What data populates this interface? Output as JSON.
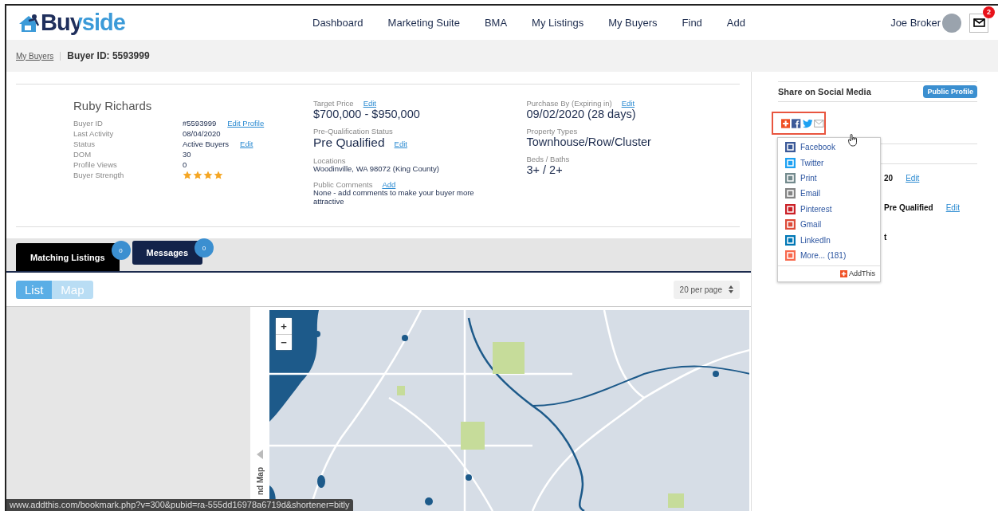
{
  "header": {
    "logo": "Buyside",
    "nav": [
      {
        "label": "Dashboard"
      },
      {
        "label": "Marketing Suite"
      },
      {
        "label": "BMA"
      },
      {
        "label": "My Listings"
      },
      {
        "label": "My Buyers"
      },
      {
        "label": "Find"
      },
      {
        "label": "Add"
      }
    ],
    "user_name": "Joe Broker",
    "mail_badge": "2"
  },
  "breadcrumb": {
    "link": "My Buyers",
    "current": "Buyer ID: 5593999"
  },
  "profile": {
    "name": "Ruby Richards",
    "fields": [
      {
        "label": "Buyer ID",
        "value": "#5593999",
        "action": "Edit Profile"
      },
      {
        "label": "Last Activity",
        "value": "08/04/2020"
      },
      {
        "label": "Status",
        "value": "Active Buyers",
        "action": "Edit"
      },
      {
        "label": "DOM",
        "value": "30"
      },
      {
        "label": "Profile Views",
        "value": "0"
      },
      {
        "label": "Buyer Strength",
        "stars": 4
      }
    ],
    "columns": [
      [
        {
          "label": "Target Price",
          "label_action": "Edit",
          "value": "$700,000 - $950,000",
          "kind": "large"
        },
        {
          "label": "Pre-Qualification Status",
          "value": "Pre Qualified",
          "value_action": "Edit",
          "kind": "xlarge"
        },
        {
          "label": "Locations",
          "value": "Woodinville, WA 98072 (King County)",
          "kind": "small"
        },
        {
          "label": "Public Comments",
          "label_action": "Add",
          "value": "None - add comments to make your buyer more attractive",
          "kind": "small"
        }
      ],
      [
        {
          "label": "Purchase By (Expiring in)",
          "label_action": "Edit",
          "value": "09/02/2020 (28 days)",
          "kind": "large"
        },
        {
          "label": "Property Types",
          "value": "Townhouse/Row/Cluster",
          "kind": "large"
        },
        {
          "label": "Beds / Baths",
          "value": "3+ / 2+",
          "kind": "large"
        }
      ]
    ]
  },
  "tabs": [
    {
      "label": "Matching Listings",
      "count": "0",
      "selected": true
    },
    {
      "label": "Messages",
      "count": "0",
      "selected": false
    }
  ],
  "view_toggle": [
    {
      "label": "List",
      "selected": true
    },
    {
      "label": "Map",
      "selected": false
    }
  ],
  "per_page": "20 per page",
  "map": {
    "zoom_in": "+",
    "zoom_out": "−",
    "expand_label": "nd Map"
  },
  "sidebar": {
    "title": "Share on Social Media",
    "public_profile": "Public Profile",
    "rows": [
      {
        "text": "20",
        "action": "Edit"
      },
      {
        "text": "Pre Qualified",
        "action": "Edit"
      },
      {
        "text": "t"
      }
    ]
  },
  "share_menu": {
    "items": [
      {
        "label": "Facebook",
        "color": "#3b5998"
      },
      {
        "label": "Twitter",
        "color": "#1da1f2"
      },
      {
        "label": "Print",
        "color": "#738a8d"
      },
      {
        "label": "Email",
        "color": "#848484"
      },
      {
        "label": "Pinterest",
        "color": "#cb2027"
      },
      {
        "label": "Gmail",
        "color": "#dd4b39"
      },
      {
        "label": "LinkedIn",
        "color": "#0077b5"
      },
      {
        "label": "More... (181)",
        "color": "#f8694d"
      }
    ],
    "footer": "AddThis"
  },
  "status_url": "www.addthis.com/bookmark.php?v=300&pubid=ra-555dd16978a6719d&shortener=bitly"
}
